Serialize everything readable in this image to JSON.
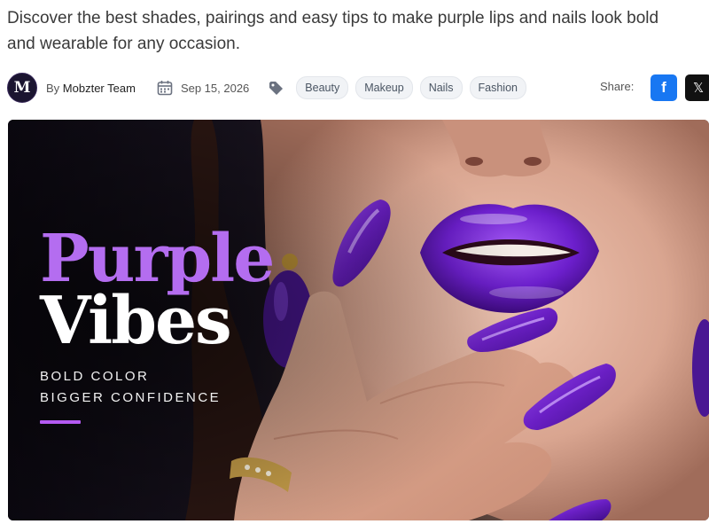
{
  "intro": {
    "line1": "Discover the best shades, pairings and easy tips to make purple lips and nails look bold",
    "line2": "and wearable for any occasion."
  },
  "meta": {
    "avatar_letter": "M",
    "by_prefix": "By",
    "author": "Mobzter Team",
    "date": "Sep 15, 2026",
    "tags": [
      "Beauty",
      "Makeup",
      "Nails",
      "Fashion"
    ],
    "share_label": "Share:",
    "facebook_glyph": "f",
    "x_glyph": "𝕏"
  },
  "hero": {
    "title_line1": "Purple",
    "title_line2": "Vibes",
    "subtitle_line1": "BOLD COLOR",
    "subtitle_line2": "BIGGER CONFIDENCE",
    "accent_color": "#b45af2"
  },
  "colors": {
    "facebook": "#1877f2",
    "x": "#111111",
    "title_purple": "#b46df0",
    "nail_purple": "#6a1fc4"
  }
}
